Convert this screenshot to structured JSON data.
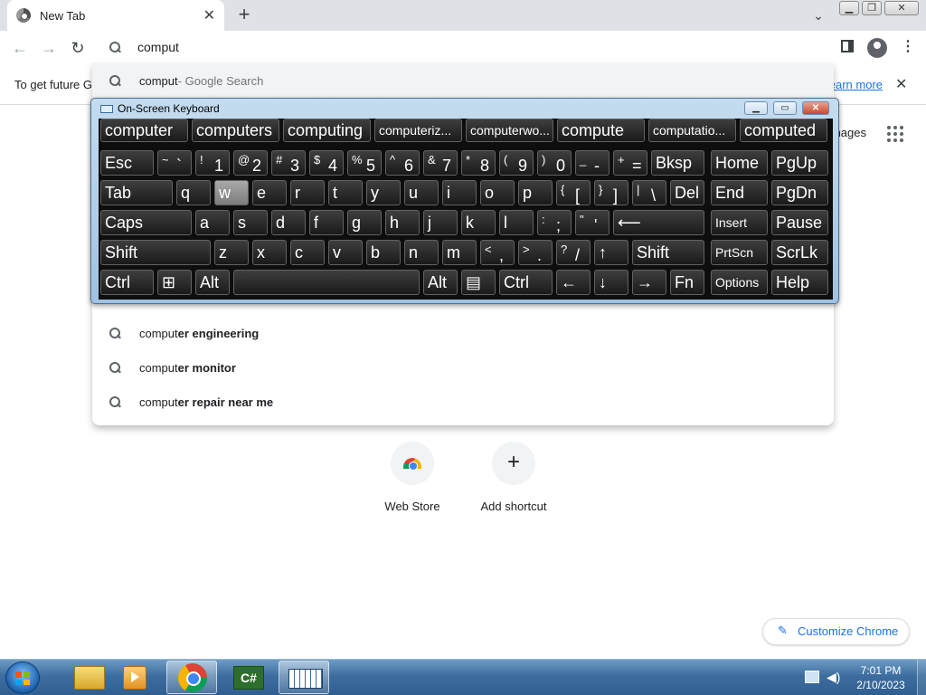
{
  "browser": {
    "tab_title": "New Tab",
    "tab_close": "✕",
    "new_tab": "+",
    "omnibox_value": "comput"
  },
  "suggestions": [
    {
      "typed": "comput",
      "rest": " - Google Search"
    },
    {
      "typed": "comput",
      "rest": "er engineering"
    },
    {
      "typed": "comput",
      "rest": "er monitor"
    },
    {
      "typed": "comput",
      "rest": "er repair near me"
    }
  ],
  "infobar": {
    "text": "To get future G",
    "learn_more": "Learn more",
    "close": "✕"
  },
  "ntp": {
    "images_link": "Images",
    "shortcuts": [
      {
        "label": "Web Store"
      },
      {
        "label": "Add shortcut"
      }
    ],
    "customize": "Customize Chrome"
  },
  "osk": {
    "title": "On-Screen Keyboard",
    "predictions": [
      "computer",
      "computers",
      "computing",
      "computeriz...",
      "computerwo...",
      "compute",
      "computatio...",
      "computed"
    ],
    "row1": [
      {
        "b": "Esc"
      },
      {
        "s": "~",
        "b": "`"
      },
      {
        "s": "!",
        "b": "1"
      },
      {
        "s": "@",
        "b": "2"
      },
      {
        "s": "#",
        "b": "3"
      },
      {
        "s": "$",
        "b": "4"
      },
      {
        "s": "%",
        "b": "5"
      },
      {
        "s": "^",
        "b": "6"
      },
      {
        "s": "&",
        "b": "7"
      },
      {
        "s": "*",
        "b": "8"
      },
      {
        "s": "(",
        "b": "9"
      },
      {
        "s": ")",
        "b": "0"
      },
      {
        "s": "_",
        "b": "-"
      },
      {
        "s": "+",
        "b": "="
      },
      {
        "b": "Bksp"
      },
      {
        "b": "Home"
      },
      {
        "b": "PgUp"
      }
    ],
    "row2": [
      {
        "b": "Tab"
      },
      {
        "b": "q"
      },
      {
        "b": "w"
      },
      {
        "b": "e"
      },
      {
        "b": "r"
      },
      {
        "b": "t"
      },
      {
        "b": "y"
      },
      {
        "b": "u"
      },
      {
        "b": "i"
      },
      {
        "b": "o"
      },
      {
        "b": "p"
      },
      {
        "s": "{",
        "b": "["
      },
      {
        "s": "}",
        "b": "]"
      },
      {
        "s": "|",
        "b": "\\"
      },
      {
        "b": "Del"
      },
      {
        "b": "End"
      },
      {
        "b": "PgDn"
      }
    ],
    "row3": [
      {
        "b": "Caps"
      },
      {
        "b": "a"
      },
      {
        "b": "s"
      },
      {
        "b": "d"
      },
      {
        "b": "f"
      },
      {
        "b": "g"
      },
      {
        "b": "h"
      },
      {
        "b": "j"
      },
      {
        "b": "k"
      },
      {
        "b": "l"
      },
      {
        "s": ":",
        "b": ";"
      },
      {
        "s": "\"",
        "b": "'"
      },
      {
        "b": "⟵"
      },
      {
        "b": "Insert"
      },
      {
        "b": "Pause"
      }
    ],
    "row4": [
      {
        "b": "Shift"
      },
      {
        "b": "z"
      },
      {
        "b": "x"
      },
      {
        "b": "c"
      },
      {
        "b": "v"
      },
      {
        "b": "b"
      },
      {
        "b": "n"
      },
      {
        "b": "m"
      },
      {
        "s": "<",
        "b": ","
      },
      {
        "s": ">",
        "b": "."
      },
      {
        "s": "?",
        "b": "/"
      },
      {
        "b": "↑"
      },
      {
        "b": "Shift"
      },
      {
        "b": "PrtScn"
      },
      {
        "b": "ScrLk"
      }
    ],
    "row5": [
      {
        "b": "Ctrl"
      },
      {
        "b": "⊞"
      },
      {
        "b": "Alt"
      },
      {
        "b": ""
      },
      {
        "b": "Alt"
      },
      {
        "b": "▤"
      },
      {
        "b": "Ctrl"
      },
      {
        "b": "←"
      },
      {
        "b": "↓"
      },
      {
        "b": "→"
      },
      {
        "b": "Fn"
      },
      {
        "b": "Options"
      },
      {
        "b": "Help"
      }
    ]
  },
  "taskbar": {
    "time": "7:01 PM",
    "date": "2/10/2023"
  },
  "colors": {
    "accent": "#1a73e8",
    "osk_frame": "#9fc2e2",
    "taskbar": "#3d6e9f"
  }
}
